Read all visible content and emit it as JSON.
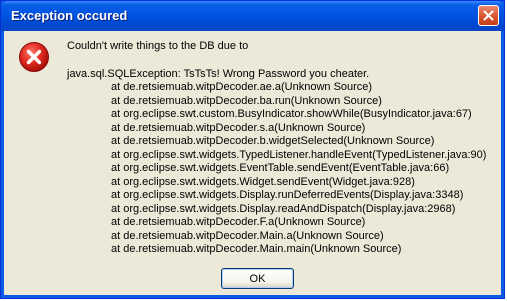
{
  "window": {
    "title": "Exception occured",
    "close_icon": "close-icon"
  },
  "dialog": {
    "icon": "error-icon",
    "message": "Couldn't write things to the DB due to",
    "exception": "java.sql.SQLException: TsTsTs! Wrong Password you cheater.",
    "stack_trace": [
      "at de.retsiemuab.witpDecoder.ae.a(Unknown Source)",
      "at de.retsiemuab.witpDecoder.ba.run(Unknown Source)",
      "at org.eclipse.swt.custom.BusyIndicator.showWhile(BusyIndicator.java:67)",
      "at de.retsiemuab.witpDecoder.s.a(Unknown Source)",
      "at de.retsiemuab.witpDecoder.b.widgetSelected(Unknown Source)",
      "at org.eclipse.swt.widgets.TypedListener.handleEvent(TypedListener.java:90)",
      "at org.eclipse.swt.widgets.EventTable.sendEvent(EventTable.java:66)",
      "at org.eclipse.swt.widgets.Widget.sendEvent(Widget.java:928)",
      "at org.eclipse.swt.widgets.Display.runDeferredEvents(Display.java:3348)",
      "at org.eclipse.swt.widgets.Display.readAndDispatch(Display.java:2968)",
      "at de.retsiemuab.witpDecoder.F.a(Unknown Source)",
      "at de.retsiemuab.witpDecoder.Main.a(Unknown Source)",
      "at de.retsiemuab.witpDecoder.Main.main(Unknown Source)"
    ],
    "ok_label": "OK"
  },
  "colors": {
    "titlebar": "#0054e3",
    "client": "#ece9d8",
    "close_button": "#d7502b",
    "error_icon": "#d8201c"
  }
}
